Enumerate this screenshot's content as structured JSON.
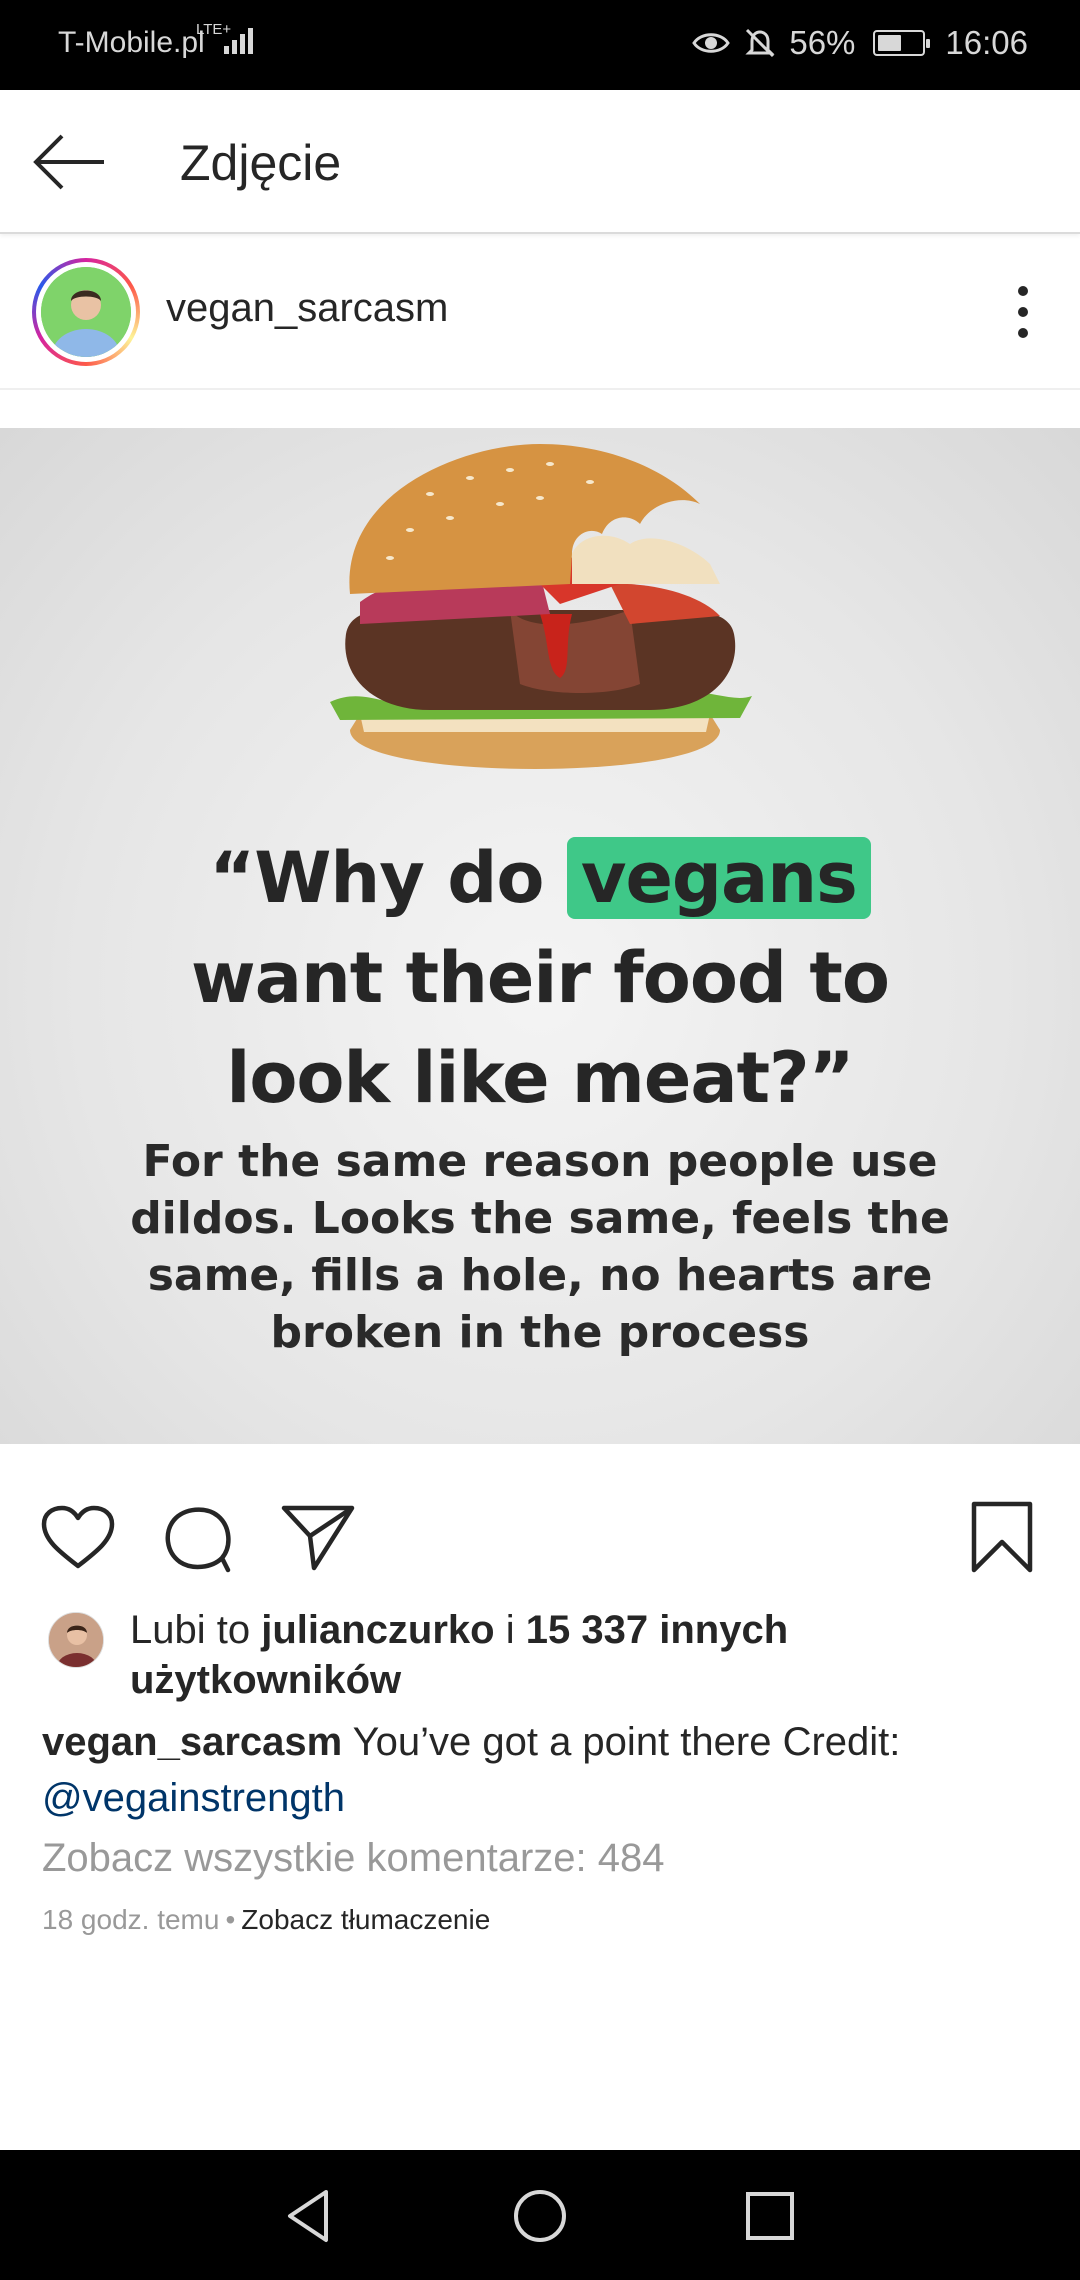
{
  "status_bar": {
    "carrier": "T-Mobile.pl",
    "network": "LTE+",
    "battery": "56%",
    "battery_level": 0.56,
    "time": "16:06",
    "icons": [
      "signal-icon",
      "eye-icon",
      "bell-off-icon",
      "battery-icon"
    ]
  },
  "app_bar": {
    "title": "Zdjęcie",
    "back_icon": "arrow-left-icon"
  },
  "post": {
    "username": "vegan_sarcasm",
    "more_icon": "more-vertical-icon",
    "image": {
      "question_pre": "“Why do ",
      "question_highlight": "vegans",
      "question_line2": "want their food to",
      "question_line3": "look like meat?”",
      "answer_lines": [
        "For the same reason people use",
        "dildos. Looks the same, feels the",
        "same, fills a hole, no hearts are",
        "broken in the process"
      ],
      "highlight_color": "#3fc888"
    },
    "actions": {
      "like_icon": "heart-icon",
      "comment_icon": "comment-icon",
      "share_icon": "send-icon",
      "save_icon": "bookmark-icon"
    },
    "likes": {
      "prefix": "Lubi to",
      "user": "julianczurko",
      "joiner": "i",
      "count": "15 337 innych",
      "suffix": "użytkowników"
    },
    "caption": {
      "user": "vegan_sarcasm",
      "text": "You’ve got a point there Credit:",
      "mention": "@vegainstrength"
    },
    "comments_link": "Zobacz wszystkie komentarze: 484",
    "time": "18 godz. temu",
    "separator": "•",
    "translate": "Zobacz tłumaczenie"
  },
  "nav_bar": {
    "icons": [
      "back-triangle-icon",
      "home-circle-icon",
      "recents-square-icon"
    ]
  }
}
